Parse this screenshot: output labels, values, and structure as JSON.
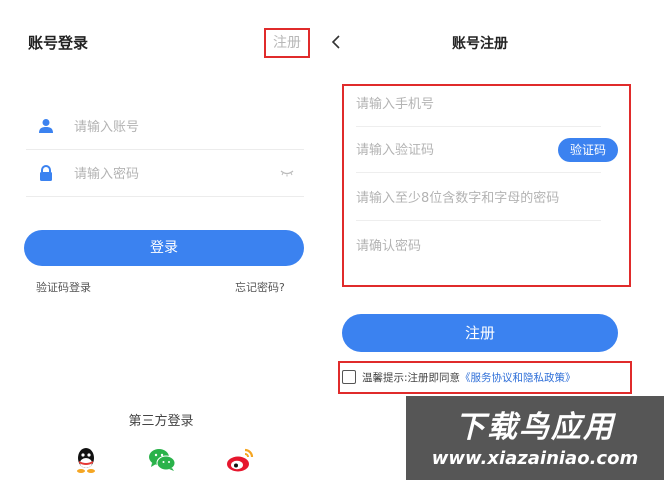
{
  "login": {
    "title": "账号登录",
    "register_link": "注册",
    "account_placeholder": "请输入账号",
    "password_placeholder": "请输入密码",
    "login_button": "登录",
    "code_login_link": "验证码登录",
    "forgot_password_link": "忘记密码?",
    "third_party_title": "第三方登录",
    "social_icons": [
      "qq-icon",
      "wechat-icon",
      "weibo-icon"
    ]
  },
  "register": {
    "title": "账号注册",
    "phone_placeholder": "请输入手机号",
    "code_placeholder": "请输入验证码",
    "code_button": "验证码",
    "password_placeholder": "请输入至少8位含数字和字母的密码",
    "confirm_placeholder": "请确认密码",
    "register_button": "注册",
    "agreement_prefix": "温馨提示:注册即同意",
    "agreement_link": "《服务协议和隐私政策》"
  },
  "watermark": {
    "main": "下载鸟应用",
    "url": "www.xiazainiao.com"
  },
  "colors": {
    "accent": "#3b82f0",
    "highlight_border": "#e02b2b",
    "placeholder": "#b3b3b3",
    "link": "#2f6fd8"
  }
}
